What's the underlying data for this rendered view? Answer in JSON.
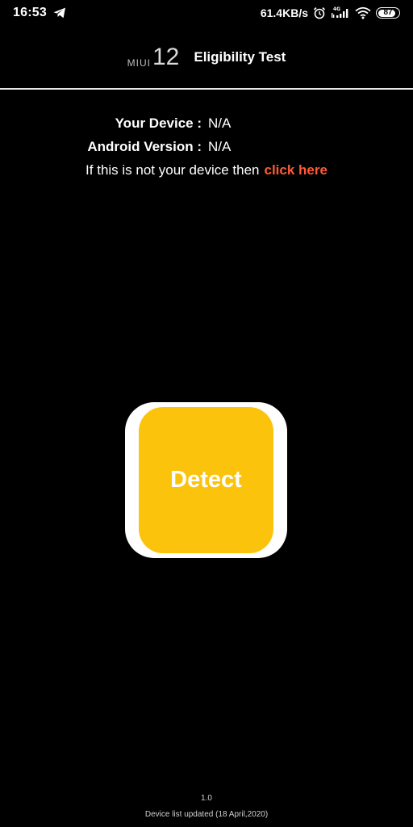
{
  "status_bar": {
    "time": "16:53",
    "net_speed": "61.4KB/s",
    "network_type": "4G",
    "battery": "87",
    "battery_level": 0.87,
    "icons": [
      "telegram-icon",
      "alarm-icon",
      "signal-icon",
      "wifi-icon",
      "battery-icon"
    ]
  },
  "header": {
    "brand_text": "MIUI",
    "brand_number": "12",
    "title": "Eligibility Test"
  },
  "device_info": {
    "device_label": "Your Device :",
    "device_value": "N/A",
    "android_label": "Android Version :",
    "android_value": "N/A"
  },
  "notice": {
    "text": "If this is not your device then",
    "link": "click here"
  },
  "detect_button": {
    "label": "Detect"
  },
  "footer": {
    "version": "1.0",
    "note": "Device list updated (18 April,2020)"
  },
  "colors": {
    "background": "#000000",
    "accent_yellow": "#fcc30d",
    "link": "#ff5a36",
    "text": "#ffffff"
  }
}
